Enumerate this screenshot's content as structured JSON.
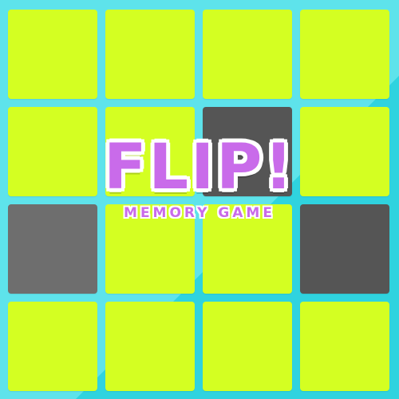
{
  "game": {
    "title": "FLIP!",
    "subtitle": "MEMORY GAME"
  },
  "colors": {
    "background": "#5ee3eb",
    "background_diagonal": "#2fd3df",
    "card_face_down": "#d4ff22",
    "card_flipped_dark": "#555555",
    "card_flipped_mid": "#6e6e6e",
    "title": "#c96bea",
    "title_outline": "#ffffff"
  },
  "board": {
    "rows": 4,
    "columns": 4,
    "cards": [
      {
        "row": 1,
        "col": 1,
        "state": "face-down"
      },
      {
        "row": 1,
        "col": 2,
        "state": "face-down"
      },
      {
        "row": 1,
        "col": 3,
        "state": "face-down"
      },
      {
        "row": 1,
        "col": 4,
        "state": "face-down"
      },
      {
        "row": 2,
        "col": 1,
        "state": "face-down"
      },
      {
        "row": 2,
        "col": 2,
        "state": "face-down"
      },
      {
        "row": 2,
        "col": 3,
        "state": "flipped-dark"
      },
      {
        "row": 2,
        "col": 4,
        "state": "face-down"
      },
      {
        "row": 3,
        "col": 1,
        "state": "flipped-mid"
      },
      {
        "row": 3,
        "col": 2,
        "state": "face-down"
      },
      {
        "row": 3,
        "col": 3,
        "state": "face-down"
      },
      {
        "row": 3,
        "col": 4,
        "state": "flipped-dark"
      },
      {
        "row": 4,
        "col": 1,
        "state": "face-down"
      },
      {
        "row": 4,
        "col": 2,
        "state": "face-down"
      },
      {
        "row": 4,
        "col": 3,
        "state": "face-down"
      },
      {
        "row": 4,
        "col": 4,
        "state": "face-down"
      }
    ]
  }
}
